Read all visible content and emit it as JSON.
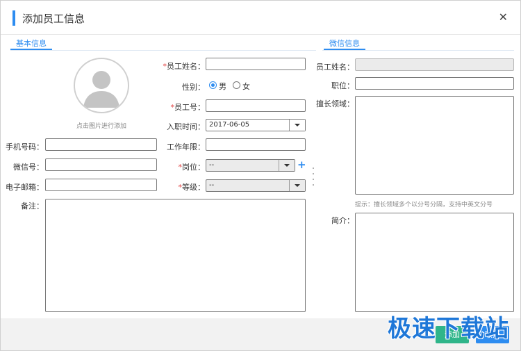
{
  "dialog": {
    "title": "添加员工信息",
    "close_icon": "close-icon"
  },
  "sections": {
    "basic": "基本信息",
    "wechat": "微信信息"
  },
  "avatar": {
    "icon": "user-avatar-icon",
    "hint": "点击图片进行添加"
  },
  "basic_form": {
    "name_label": "员工姓名：",
    "gender_label": "性别：",
    "gender_options": [
      "男",
      "女"
    ],
    "gender_selected": "男",
    "emp_no_label": "员工号：",
    "join_date_label": "入职时间：",
    "join_date_value": "2017-06-05",
    "work_years_label": "工作年限：",
    "phone_label": "手机号码：",
    "wechat_label": "微信号：",
    "email_label": "电子邮箱：",
    "post_label": "岗位：",
    "post_value": "--",
    "level_label": "等级：",
    "level_value": "--",
    "remark_label": "备注：",
    "required_mark": "*"
  },
  "wechat_form": {
    "name_label": "员工姓名：",
    "position_label": "职位：",
    "expertise_label": "擅长领域：",
    "expertise_hint": "提示：擅长领域多个以分号分隔，支持中英文分号",
    "intro_label": "简介："
  },
  "footer": {
    "add_label": "添加",
    "cancel_label": "取消"
  },
  "watermark": "极速下载站",
  "colors": {
    "accent": "#2d8cf0",
    "add_button": "#2fb58a",
    "required": "#e04040"
  }
}
